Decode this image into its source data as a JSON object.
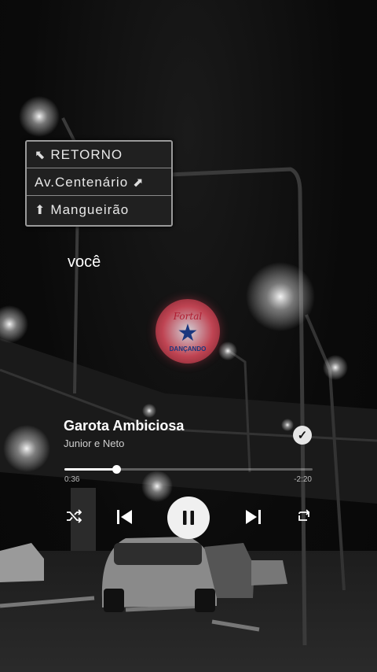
{
  "sign": {
    "lines": [
      {
        "text": "RETORNO",
        "icon": "arrow-up-left-icon"
      },
      {
        "text": "Av.Centenário",
        "icon": "arrow-up-right-icon"
      },
      {
        "text": "Mangueirão",
        "icon": "arrow-up-icon"
      }
    ]
  },
  "lyric": {
    "current_line": "você"
  },
  "sticker": {
    "text_top": "Fortal",
    "text_bottom": "DANÇANDO"
  },
  "player": {
    "title": "Garota Ambiciosa",
    "artist": "Junior e Neto",
    "liked": true,
    "elapsed": "0:36",
    "remaining": "-2:20",
    "progress_fraction": 0.21,
    "state": "playing"
  },
  "colors": {
    "accent": "#ffffff",
    "background": "#0b0b0b"
  }
}
